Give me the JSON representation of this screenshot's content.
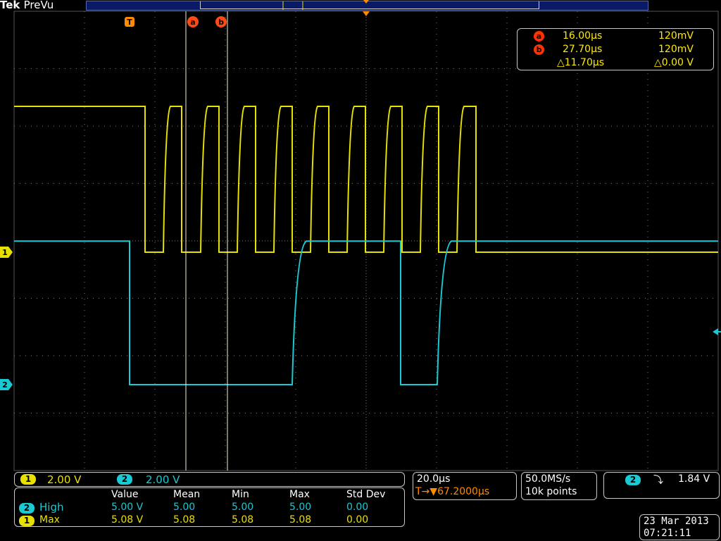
{
  "brand": {
    "name": "Tek",
    "mode": "PreVu"
  },
  "colors": {
    "ch1": "#e8e000",
    "ch2": "#19c9d3",
    "cursor": "#ff4a14",
    "trigger": "#ff8c00",
    "graticule": "#7a7a7a",
    "label": "#ffea00"
  },
  "markers": {
    "trigger_label": "T",
    "cursor_a_label": "a",
    "cursor_b_label": "b",
    "ch1_ground_label": "1",
    "ch2_ground_label": "2"
  },
  "cursors": {
    "a": {
      "label": "a",
      "time": "16.00µs",
      "volts": "120mV"
    },
    "b": {
      "label": "b",
      "time": "27.70µs",
      "volts": "120mV"
    },
    "delta_time": "△11.70µs",
    "delta_volts": "△0.00 V"
  },
  "waveform": {
    "time_per_div": 20.0,
    "ch1": {
      "volts_per_div": 2.0,
      "high_v": 5.08,
      "low_v": 0.0
    },
    "ch2": {
      "volts_per_div": 2.0,
      "high_v": 5.0,
      "low_v": 0.0
    }
  },
  "channels": {
    "ch1": {
      "badge": "1",
      "scale": "2.00 V"
    },
    "ch2": {
      "badge": "2",
      "scale": "2.00 V"
    }
  },
  "horizontal": {
    "scale": "20.0µs",
    "trigger_pos": "67.2000µs",
    "trigger_icon": "T→▼"
  },
  "acquisition": {
    "rate": "50.0MS/s",
    "points": "10k points"
  },
  "trigger": {
    "source": "2",
    "slope_icon": "falling-edge",
    "slope_glyph": "⤵",
    "level": "1.84 V"
  },
  "measurements": {
    "headers": [
      "Value",
      "Mean",
      "Min",
      "Max",
      "Std Dev"
    ],
    "rows": [
      {
        "badge": "2",
        "name": "High",
        "value": "5.00 V",
        "mean": "5.00",
        "min": "5.00",
        "max": "5.00",
        "std": "0.00"
      },
      {
        "badge": "1",
        "name": "Max",
        "value": "5.08 V",
        "mean": "5.08",
        "min": "5.08",
        "max": "5.08",
        "std": "0.00"
      }
    ]
  },
  "datetime": {
    "date": "23 Mar 2013",
    "time": "07:21:11"
  }
}
